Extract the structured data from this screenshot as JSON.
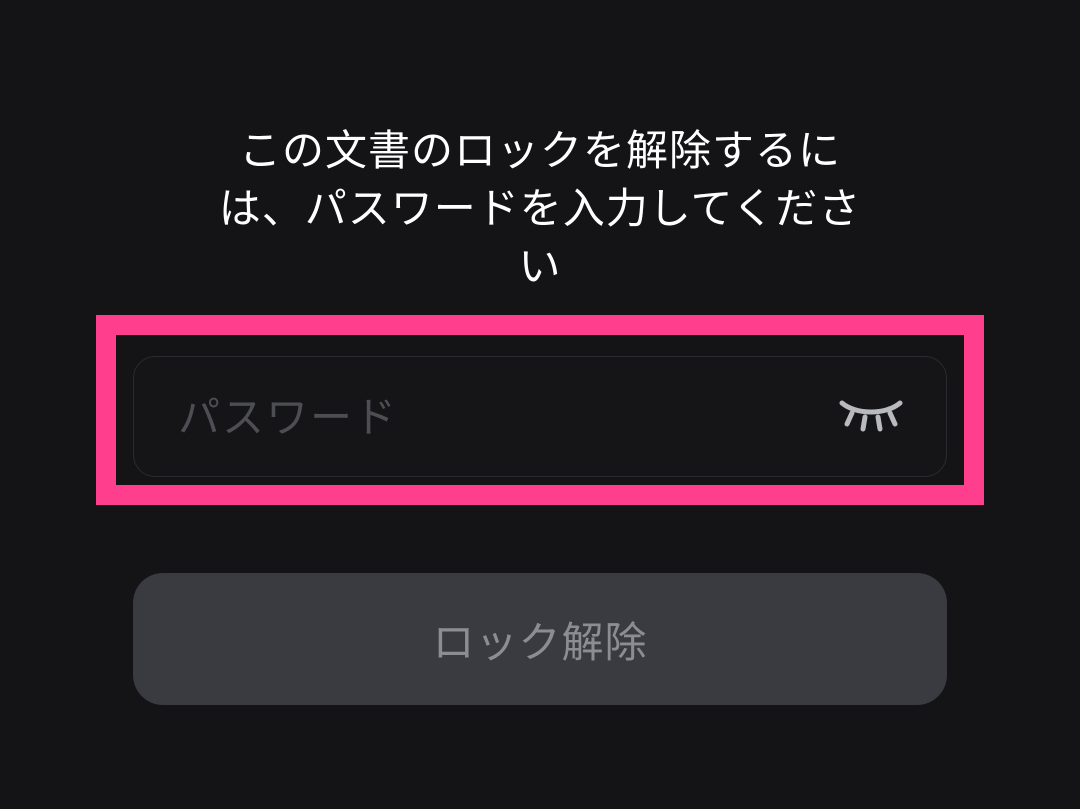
{
  "dialog": {
    "prompt": "この文書のロックを解除するには、パスワードを入力してください",
    "password": {
      "value": "",
      "placeholder": "パスワード",
      "visibility_icon": "eye-closed-icon"
    },
    "unlock_label": "ロック解除",
    "unlock_enabled": false
  },
  "highlight": {
    "color": "#ff3f8e"
  },
  "colors": {
    "background": "#141416",
    "button_background": "#393b40",
    "button_text": "#8b8d92",
    "placeholder": "#4d4e53"
  }
}
